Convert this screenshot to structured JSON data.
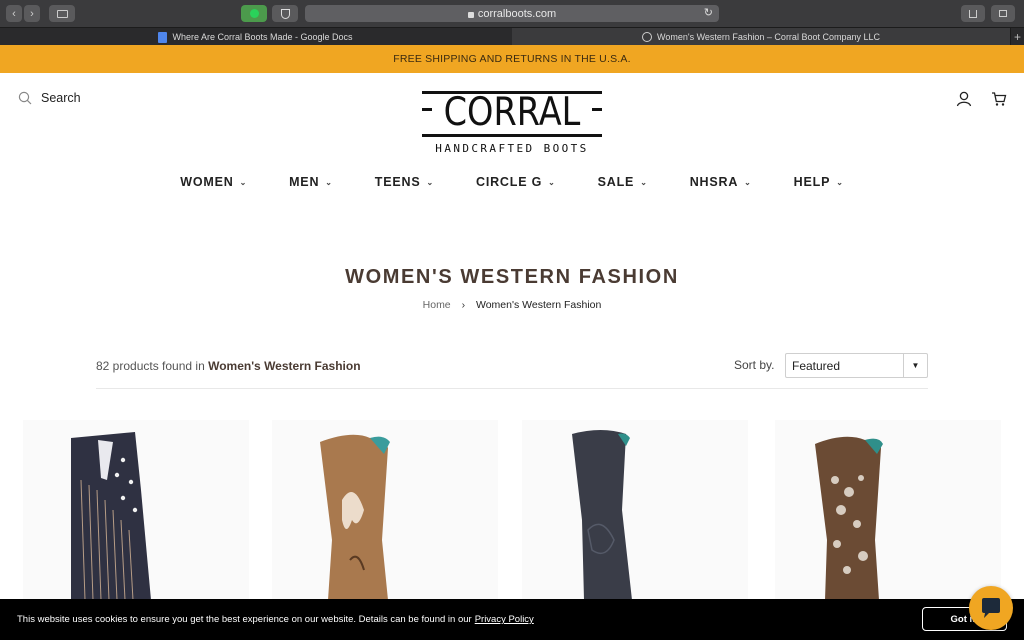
{
  "browser": {
    "url": "corralboots.com",
    "tabs": [
      {
        "label": "Where Are Corral Boots Made - Google Docs",
        "active": false
      },
      {
        "label": "Women's Western Fashion – Corral Boot Company LLC",
        "active": true
      }
    ]
  },
  "announcement": "FREE SHIPPING AND RETURNS IN THE U.S.A.",
  "header": {
    "search_label": "Search",
    "logo_word": "CORRAL",
    "logo_sub": "HANDCRAFTED BOOTS",
    "icons": [
      "account-icon",
      "cart-icon"
    ]
  },
  "nav": {
    "items": [
      "WOMEN",
      "MEN",
      "TEENS",
      "CIRCLE G",
      "SALE",
      "NHSRA",
      "HELP"
    ]
  },
  "page": {
    "title": "WOMEN'S WESTERN FASHION",
    "breadcrumb": {
      "home": "Home",
      "current": "Women's Western Fashion"
    },
    "count_prefix": "82 products found in",
    "count_collection": "Women's Western Fashion",
    "sort_label": "Sort by.",
    "sort_value": "Featured"
  },
  "products": [
    {
      "name": "fringe-star-boot",
      "color": "#2f3142"
    },
    {
      "name": "tan-embroidered-boot",
      "color": "#a9794e"
    },
    {
      "name": "black-boot",
      "color": "#3a3d48"
    },
    {
      "name": "glitter-inlay-boot",
      "color": "#6b4b34"
    }
  ],
  "cookie": {
    "text": "This website uses cookies to ensure you get the best experience on our website. Details can be found in our",
    "link": "Privacy Policy",
    "button": "Got it!"
  },
  "colors": {
    "accent": "#f0a622",
    "title": "#4a3b33"
  }
}
